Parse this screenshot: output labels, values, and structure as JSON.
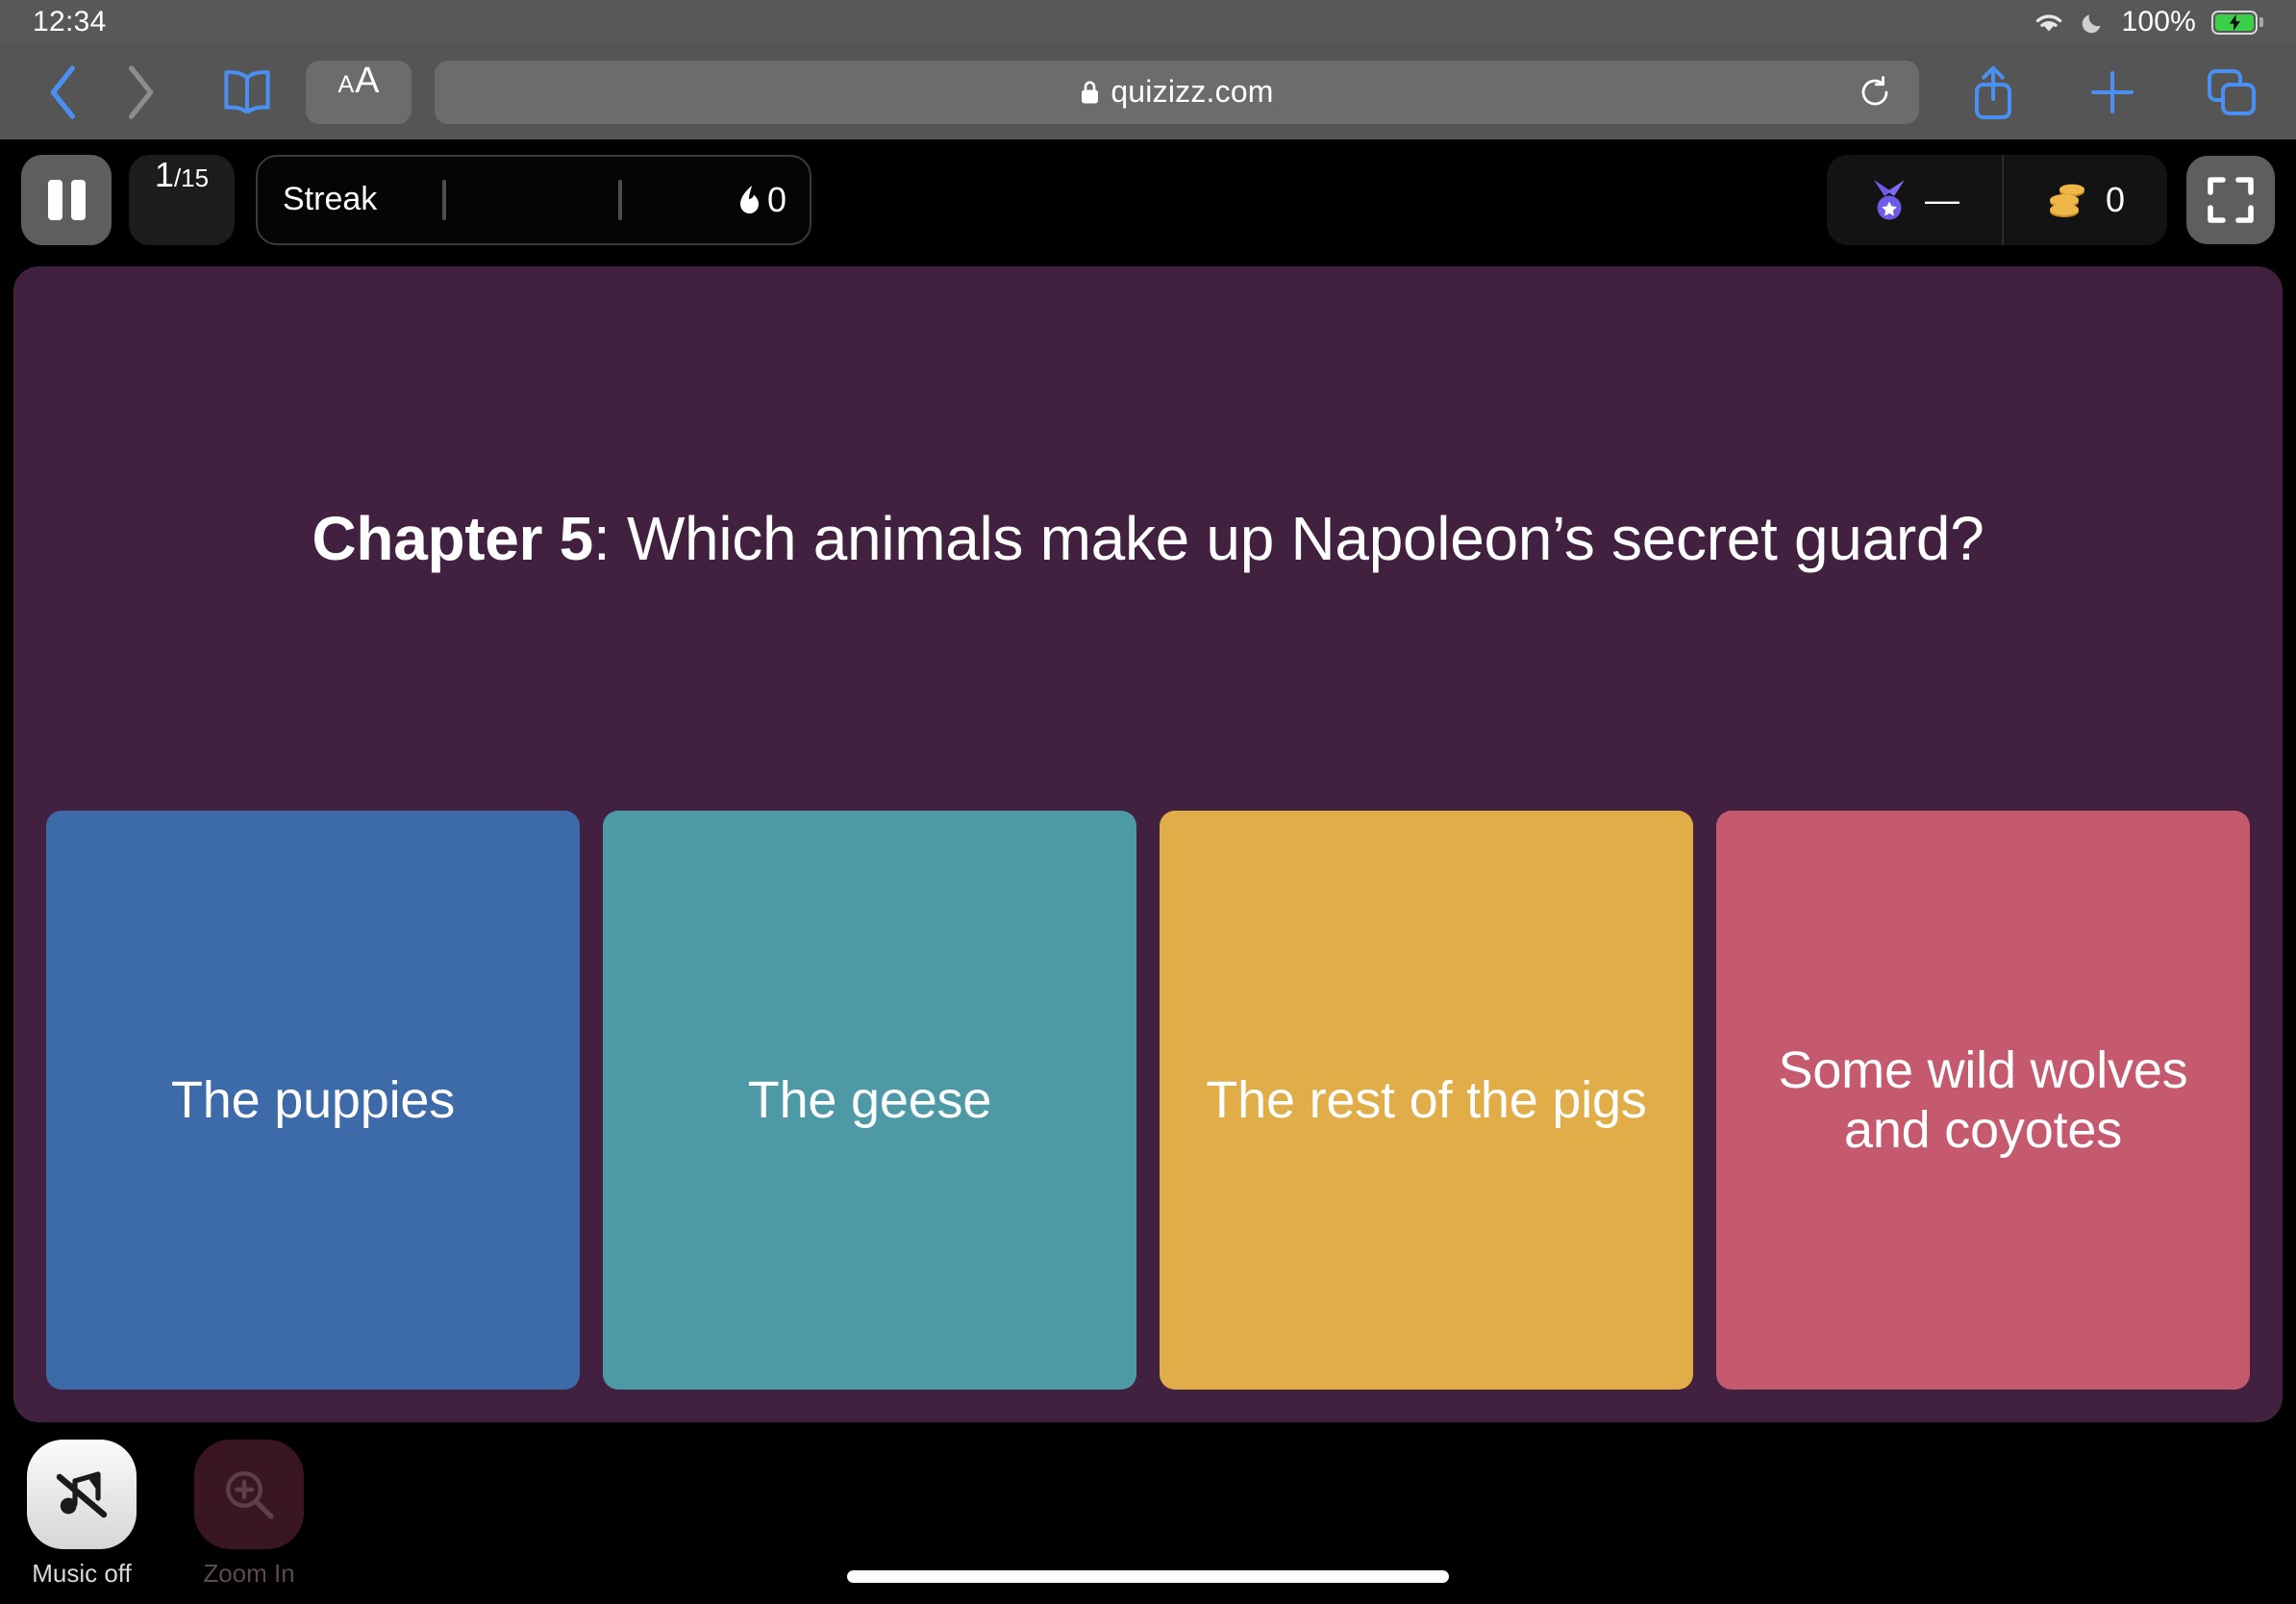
{
  "status_bar": {
    "time": "12:34",
    "battery_percent": "100%",
    "icons": [
      "wifi-icon",
      "moon-icon",
      "battery-charging-icon"
    ]
  },
  "browser": {
    "back_icon": "chevron-left-icon",
    "forward_icon": "chevron-right-icon",
    "bookmarks_icon": "book-icon",
    "text_size_small": "A",
    "text_size_large": "A",
    "url": "quizizz.com",
    "lock_icon": "lock-icon",
    "reload_icon": "reload-icon",
    "share_icon": "share-icon",
    "new_tab_icon": "plus-icon",
    "tabs_icon": "tabs-icon"
  },
  "quiz_header": {
    "pause_icon": "pause-icon",
    "question_current": "1",
    "question_total": "/15",
    "streak_label": "Streak",
    "streak_count": "0",
    "flame_icon": "flame-icon",
    "medal_icon": "medal-icon",
    "rank_value": "—",
    "coins_icon": "coins-icon",
    "coins_value": "0",
    "fullscreen_icon": "fullscreen-icon"
  },
  "question": {
    "prefix": "Chapter 5",
    "body": ": Which animals make up Napoleon’s secret guard?"
  },
  "answers": [
    {
      "label": "The puppies",
      "color": "#3d6aa8"
    },
    {
      "label": "The geese",
      "color": "#4d99a6"
    },
    {
      "label": "The rest of the pigs",
      "color": "#e0ad49"
    },
    {
      "label": "Some wild wolves and coyotes",
      "color": "#c55a6e"
    }
  ],
  "bottom_bar": {
    "music_label": "Music off",
    "music_icon": "music-note-slash-icon",
    "zoom_label": "Zoom In",
    "zoom_icon": "magnifier-plus-icon"
  },
  "theme": {
    "panel_bg": "#42203f",
    "page_bg": "#000000",
    "chrome_bg": "#555555",
    "accent_blue": "#4a90f2"
  }
}
